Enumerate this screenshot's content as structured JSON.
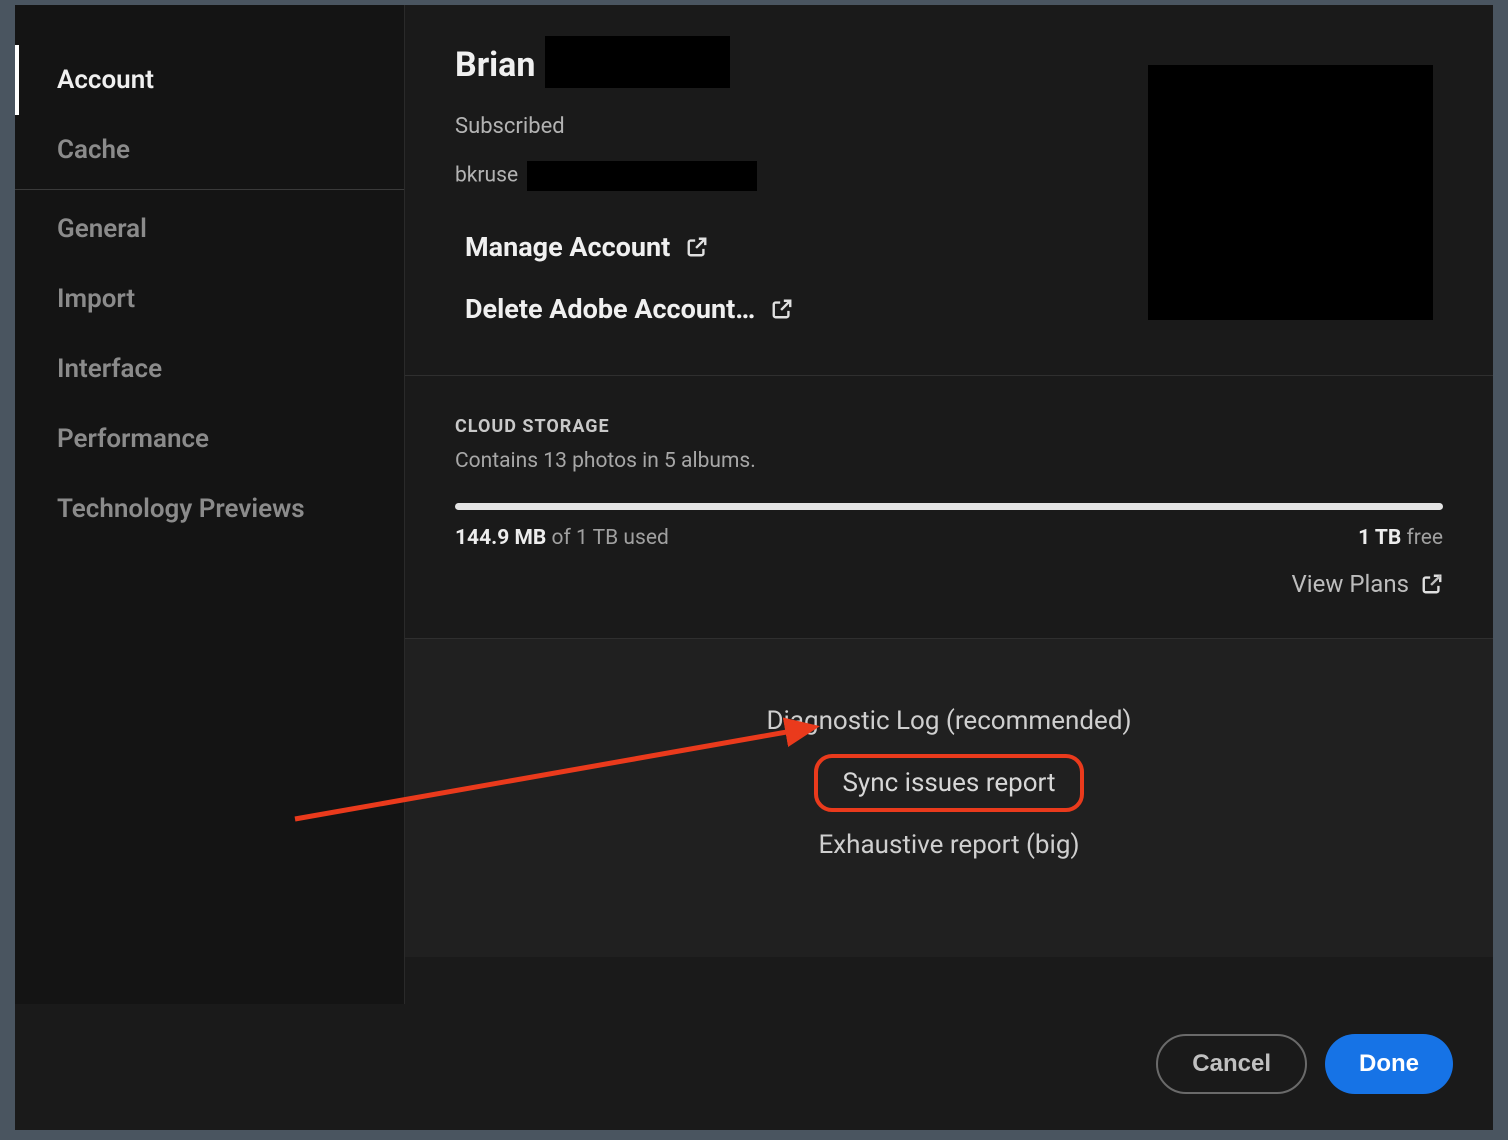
{
  "sidebar": {
    "items": [
      {
        "label": "Account",
        "active": true
      },
      {
        "label": "Cache",
        "active": false
      },
      {
        "label": "General",
        "active": false
      },
      {
        "label": "Import",
        "active": false
      },
      {
        "label": "Interface",
        "active": false
      },
      {
        "label": "Performance",
        "active": false
      },
      {
        "label": "Technology Previews",
        "active": false
      }
    ]
  },
  "account": {
    "name": "Brian",
    "status": "Subscribed",
    "email_prefix": "bkruse",
    "manage_label": "Manage Account",
    "delete_label": "Delete Adobe Account…"
  },
  "cloud": {
    "heading": "CLOUD STORAGE",
    "summary": "Contains 13 photos in 5 albums.",
    "used_amount": "144.9 MB",
    "used_suffix": "of 1 TB used",
    "free_amount": "1 TB",
    "free_suffix": "free",
    "view_plans": "View Plans"
  },
  "diagnostics": {
    "option1": "Diagnostic Log (recommended)",
    "option2": "Sync issues report",
    "option3": "Exhaustive report (big)"
  },
  "footer": {
    "cancel": "Cancel",
    "done": "Done"
  },
  "annotation": {
    "color": "#ea3a1c"
  }
}
